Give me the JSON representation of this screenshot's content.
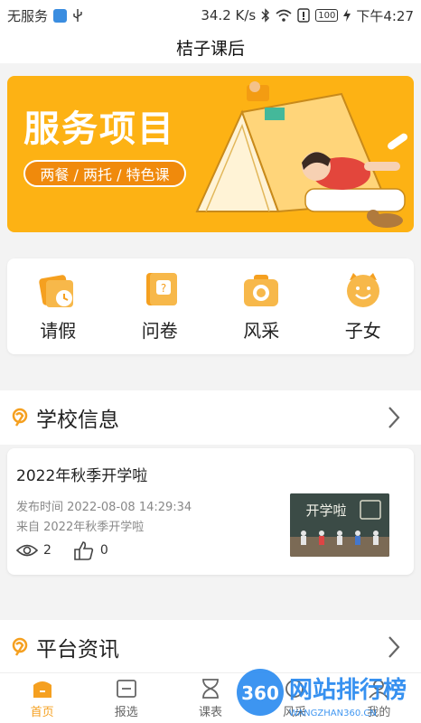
{
  "status_bar": {
    "carrier": "无服务",
    "speed": "34.2 K/s",
    "battery": "100",
    "time": "下午4:27"
  },
  "header": {
    "title": "桔子课后"
  },
  "banner": {
    "title": "服务项目",
    "tagline": "两餐 / 两托 / 特色课"
  },
  "quick_actions": [
    {
      "label": "请假",
      "icon": "leave-calendar-icon"
    },
    {
      "label": "问卷",
      "icon": "survey-question-icon"
    },
    {
      "label": "风采",
      "icon": "camera-icon"
    },
    {
      "label": "子女",
      "icon": "child-face-icon"
    }
  ],
  "school_info": {
    "title": "学校信息",
    "news": {
      "title": "2022年秋季开学啦",
      "published": "发布时间 2022-08-08 14:29:34",
      "source": "来自 2022年秋季开学啦",
      "views": "2",
      "likes": "0",
      "thumb_text": "开学啦"
    }
  },
  "platform_news": {
    "title": "平台资讯"
  },
  "tab_bar": [
    {
      "label": "首页",
      "icon": "home-icon",
      "active": true
    },
    {
      "label": "报选",
      "icon": "book-icon"
    },
    {
      "label": "课表",
      "icon": "hourglass-icon"
    },
    {
      "label": "风采",
      "icon": "style-icon"
    },
    {
      "label": "我的",
      "icon": "profile-icon"
    }
  ],
  "watermark": {
    "badge": "360",
    "text": "网站排行榜",
    "sub": "WANGZHAN360.CN"
  },
  "colors": {
    "accent": "#f5a020",
    "banner": "#fdb214",
    "tag": "#f08a0c"
  }
}
